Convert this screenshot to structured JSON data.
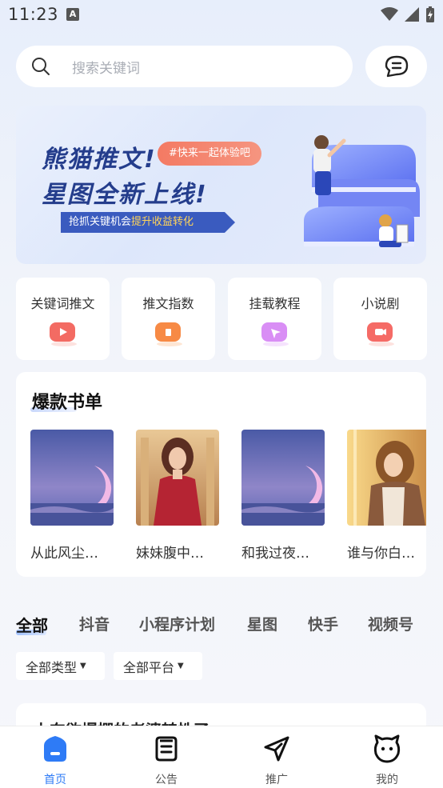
{
  "status_bar": {
    "time": "11:23",
    "notification_badge": "A"
  },
  "search": {
    "placeholder": "搜索关键词"
  },
  "banner": {
    "title_line1": "熊猫推文!",
    "title_line2": "星图全新上线!",
    "tag": "#快来一起体验吧",
    "strip_prefix": "抢抓关键机会",
    "strip_highlight": "提升收益转化"
  },
  "tiles": [
    {
      "label": "关键词推文",
      "icon": "keyword-video-icon",
      "color": "#f36b63"
    },
    {
      "label": "推文指数",
      "icon": "index-icon",
      "color": "#f78a45"
    },
    {
      "label": "挂载教程",
      "icon": "tutorial-icon",
      "color": "#d98ef5"
    },
    {
      "label": "小说剧",
      "icon": "drama-icon",
      "color": "#f56b66"
    }
  ],
  "books": {
    "title": "爆款书单",
    "items": [
      {
        "name": "从此风尘…"
      },
      {
        "name": "妹妹腹中…"
      },
      {
        "name": "和我过夜…"
      },
      {
        "name": "谁与你白…"
      }
    ]
  },
  "category_tabs": [
    "全部",
    "抖音",
    "小程序计划",
    "星图",
    "快手",
    "视频号"
  ],
  "filters": [
    {
      "label": "全部类型"
    },
    {
      "label": "全部平台"
    }
  ],
  "list": {
    "first_item_title": "上东欲爆棚的老婆转性了"
  },
  "bottom_nav": [
    {
      "label": "首页",
      "icon": "home-icon",
      "active": true
    },
    {
      "label": "公告",
      "icon": "announcement-icon",
      "active": false
    },
    {
      "label": "推广",
      "icon": "promote-icon",
      "active": false
    },
    {
      "label": "我的",
      "icon": "profile-icon",
      "active": false
    }
  ],
  "colors": {
    "accent": "#2e7bf6",
    "banner_text": "#243d8c",
    "tag_bg": "#f47a63"
  }
}
